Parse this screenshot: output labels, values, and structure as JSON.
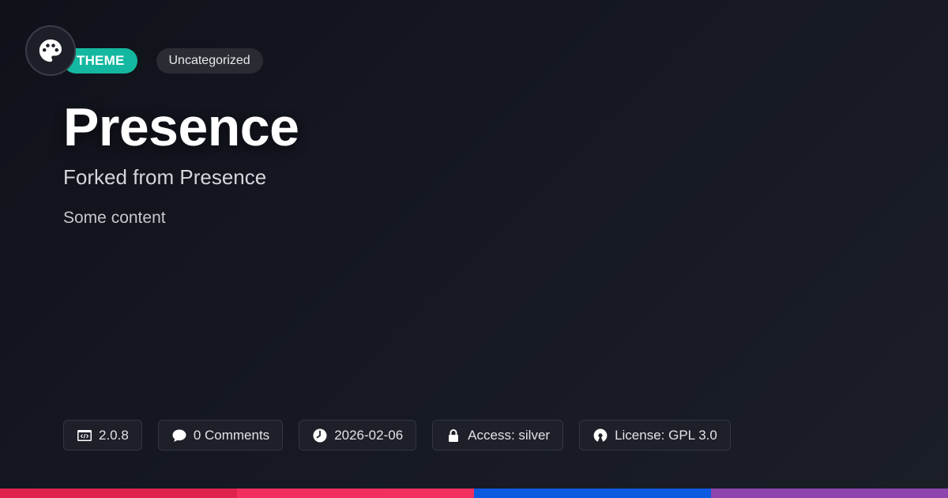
{
  "header": {
    "logo_icon": "palette-icon",
    "type_badge": "THEME",
    "category_badge": "Uncategorized"
  },
  "main": {
    "title": "Presence",
    "subtitle": "Forked from Presence",
    "content": "Some content"
  },
  "meta": {
    "version": "2.0.8",
    "comments": "0 Comments",
    "date": "2026-02-06",
    "access": "Access: silver",
    "license": "License: GPL 3.0"
  },
  "colors": {
    "accent": "#14b8a0",
    "stripes": [
      "#e0234e",
      "#f2305f",
      "#0a5be0",
      "#8e44ad"
    ]
  }
}
